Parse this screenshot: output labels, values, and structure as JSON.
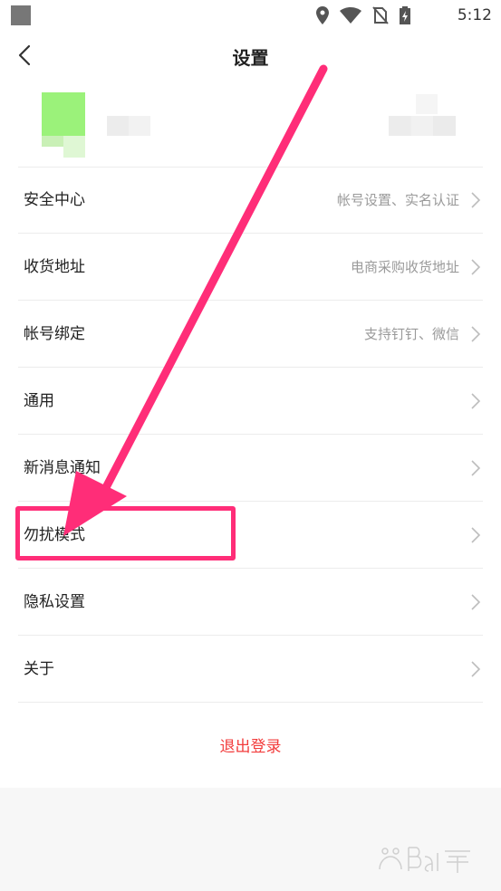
{
  "status_bar": {
    "time": "5:12",
    "icons": [
      "location-icon",
      "wifi-icon",
      "no-sim-icon",
      "battery-charging-icon"
    ]
  },
  "header": {
    "title": "设置"
  },
  "menu": {
    "items": [
      {
        "label": "安全中心",
        "hint": "帐号设置、实名认证"
      },
      {
        "label": "收货地址",
        "hint": "电商采购收货地址"
      },
      {
        "label": "帐号绑定",
        "hint": "支持钉钉、微信"
      },
      {
        "label": "通用",
        "hint": ""
      },
      {
        "label": "新消息通知",
        "hint": ""
      },
      {
        "label": "勿扰模式",
        "hint": ""
      },
      {
        "label": "隐私设置",
        "hint": ""
      },
      {
        "label": "关于",
        "hint": ""
      }
    ]
  },
  "logout_label": "退出登录",
  "colors": {
    "accent_red": "#f23c3c",
    "annotation_pink": "#ff2d78",
    "avatar_green": "#9bf27a"
  }
}
